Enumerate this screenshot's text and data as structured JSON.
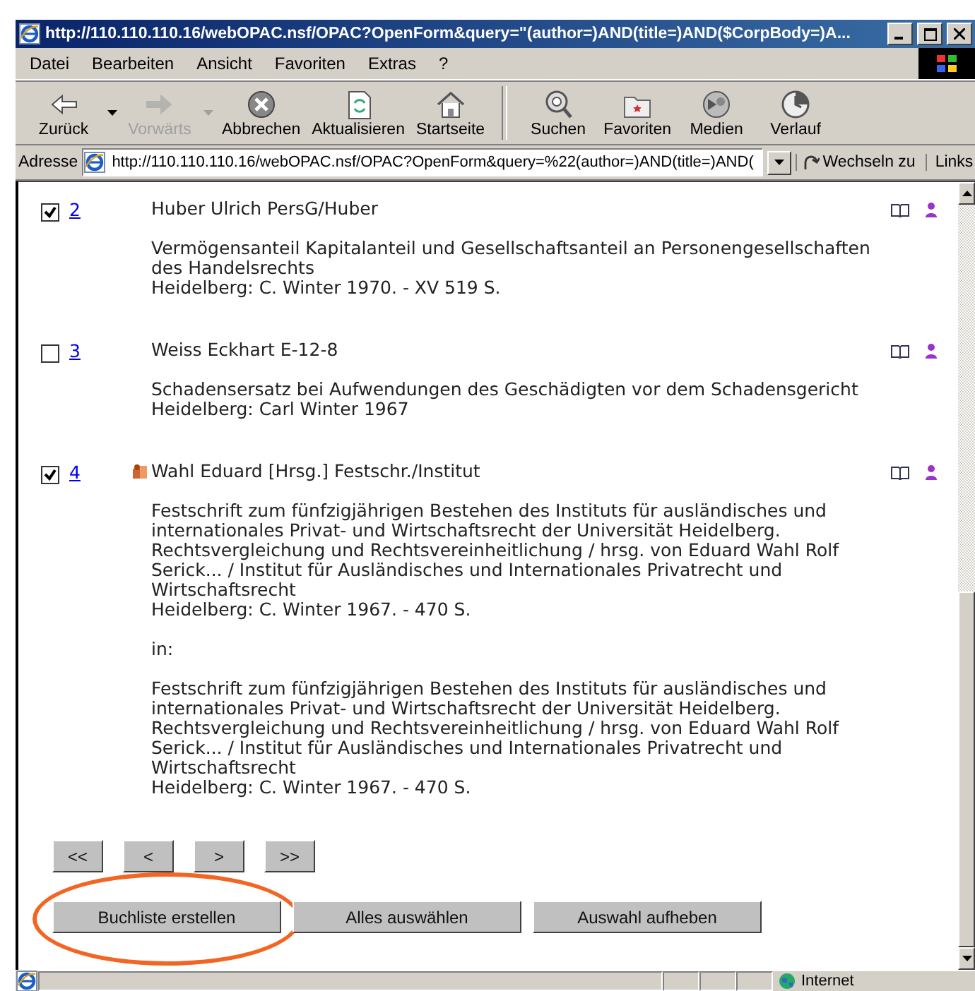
{
  "window": {
    "title": "http://110.110.110.16/webOPAC.nsf/OPAC?OpenForm&query=\"(author=)AND(title=)AND($CorpBody=)A..."
  },
  "menu": [
    "Datei",
    "Bearbeiten",
    "Ansicht",
    "Favoriten",
    "Extras",
    "?"
  ],
  "toolbar": [
    {
      "label": "Zurück",
      "kind": "back",
      "disabled": false,
      "dropdown": true
    },
    {
      "label": "Vorwärts",
      "kind": "forward",
      "disabled": true,
      "dropdown": true
    },
    {
      "label": "Abbrechen",
      "kind": "stop",
      "disabled": false,
      "dropdown": false
    },
    {
      "label": "Aktualisieren",
      "kind": "refresh",
      "disabled": false,
      "dropdown": false
    },
    {
      "label": "Startseite",
      "kind": "home",
      "disabled": false,
      "dropdown": false
    },
    {
      "label": "Suchen",
      "kind": "search",
      "disabled": false,
      "dropdown": false
    },
    {
      "label": "Favoriten",
      "kind": "favorites",
      "disabled": false,
      "dropdown": false
    },
    {
      "label": "Medien",
      "kind": "media",
      "disabled": false,
      "dropdown": false
    },
    {
      "label": "Verlauf",
      "kind": "history",
      "disabled": false,
      "dropdown": false
    }
  ],
  "address": {
    "label": "Adresse",
    "value": "http://110.110.110.16/webOPAC.nsf/OPAC?OpenForm&query=%22(author=)AND(title=)AND(",
    "go": "Wechseln zu",
    "links": "Links"
  },
  "results": [
    {
      "number": "2",
      "checked": true,
      "multi_icon": false,
      "heading": "Huber Ulrich PersG/Huber",
      "blocks": [
        [
          "Vermögensanteil Kapitalanteil und Gesellschaftsanteil an Personengesellschaften",
          "des Handelsrechts",
          "Heidelberg: C. Winter 1970. - XV 519 S."
        ]
      ]
    },
    {
      "number": "3",
      "checked": false,
      "multi_icon": false,
      "heading": "Weiss Eckhart E-12-8",
      "blocks": [
        [
          "Schadensersatz bei Aufwendungen des Geschädigten vor dem Schadensgericht",
          "Heidelberg: Carl Winter 1967"
        ]
      ]
    },
    {
      "number": "4",
      "checked": true,
      "multi_icon": true,
      "heading": "Wahl Eduard [Hrsg.] Festschr./Institut",
      "blocks": [
        [
          "Festschrift zum fünfzigjährigen Bestehen des Instituts für ausländisches und",
          "internationales Privat- und Wirtschaftsrecht der Universität Heidelberg.",
          "Rechtsvergleichung und Rechtsvereinheitlichung / hrsg. von Eduard Wahl Rolf",
          "Serick... / Institut für Ausländisches und Internationales Privatrecht und",
          "Wirtschaftsrecht",
          "Heidelberg: C. Winter 1967. - 470 S."
        ],
        [
          "in:"
        ],
        [
          "Festschrift zum fünfzigjährigen Bestehen des Instituts für ausländisches und",
          "internationales Privat- und Wirtschaftsrecht der Universität Heidelberg.",
          "Rechtsvergleichung und Rechtsvereinheitlichung / hrsg. von Eduard Wahl Rolf",
          "Serick... / Institut für Ausländisches und Internationales Privatrecht und",
          "Wirtschaftsrecht",
          "Heidelberg: C. Winter 1967. - 470 S."
        ]
      ]
    }
  ],
  "pager": [
    "<<",
    "<",
    ">",
    ">>"
  ],
  "actions": [
    {
      "label": "Buchliste erstellen",
      "highlighted": true
    },
    {
      "label": "Alles auswählen",
      "highlighted": false
    },
    {
      "label": "Auswahl aufheben",
      "highlighted": false
    }
  ],
  "status_bar": {
    "zone": "Internet"
  }
}
